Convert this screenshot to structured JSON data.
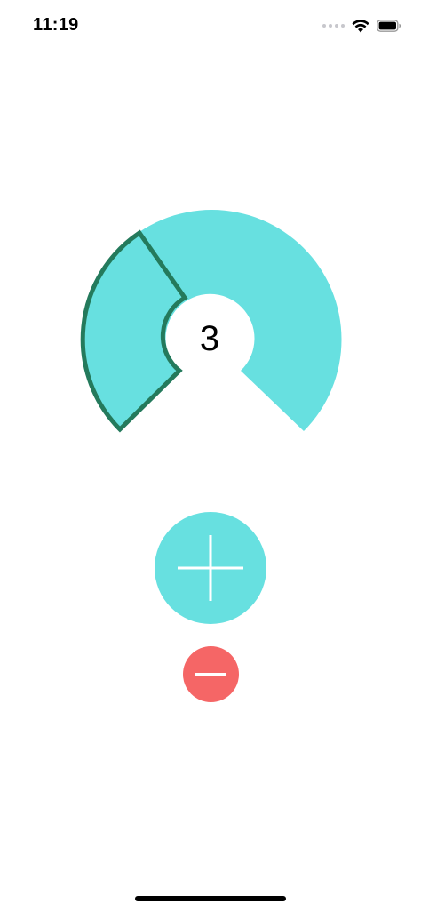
{
  "status_bar": {
    "time": "11:19",
    "icons": [
      "signal-dots-icon",
      "wifi-icon",
      "battery-icon"
    ]
  },
  "gauge": {
    "value": "3",
    "colors": {
      "fill": "#67e0e0",
      "highlight_stroke": "#247a5c"
    }
  },
  "controls": {
    "increment_icon": "plus-icon",
    "decrement_icon": "minus-icon",
    "increment_color": "#67e0e0",
    "decrement_color": "#f56666"
  }
}
